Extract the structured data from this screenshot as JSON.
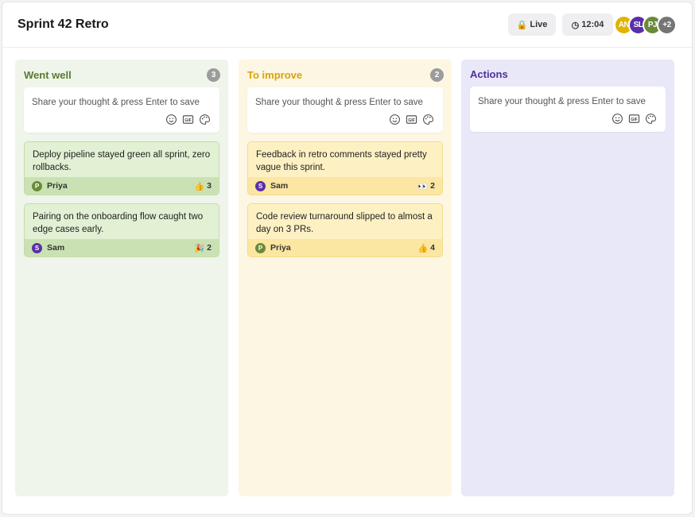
{
  "header": {
    "title": "Sprint 42 Retro",
    "live_label": "Live",
    "live_icon": "lock-icon",
    "timer_label": "12:04",
    "timer_icon": "clock-icon"
  },
  "participants": {
    "avatars": [
      {
        "initials": "AN",
        "color": "#e0b400"
      },
      {
        "initials": "SL",
        "color": "#5b2fa8"
      },
      {
        "initials": "PJ",
        "color": "#6a8a3a"
      }
    ],
    "overflow_label": "+2",
    "overflow_color": "#757575"
  },
  "columns": [
    {
      "title": "Went well",
      "count": "3",
      "color": "#5a7a2f",
      "placeholder": "Share your thought & press Enter to save",
      "cards": [
        {
          "text": "Deploy pipeline stayed green all sprint, zero rollbacks.",
          "author": "Priya",
          "initial": "P",
          "avatar_color": "#6a8a3a",
          "reaction": "👍",
          "reaction_count": "3"
        },
        {
          "text": "Pairing on the onboarding flow caught two edge cases early.",
          "author": "Sam",
          "initial": "S",
          "avatar_color": "#5b2fa8",
          "reaction": "🎉",
          "reaction_count": "2"
        }
      ]
    },
    {
      "title": "To improve",
      "count": "2",
      "color": "#d7a40c",
      "placeholder": "Share your thought & press Enter to save",
      "cards": [
        {
          "text": "Feedback in retro comments stayed pretty vague this sprint.",
          "author": "Sam",
          "initial": "S",
          "avatar_color": "#5b2fa8",
          "reaction": "👀",
          "reaction_count": "2"
        },
        {
          "text": "Code review turnaround slipped to almost a day on 3 PRs.",
          "author": "Priya",
          "initial": "P",
          "avatar_color": "#6a8a3a",
          "reaction": "👍",
          "reaction_count": "4"
        }
      ]
    },
    {
      "title": "Actions",
      "color": "#4f2f98",
      "placeholder": "Share your thought & press Enter to save",
      "cards": []
    }
  ],
  "input_tools": [
    "emoji-icon",
    "gif-icon",
    "palette-icon"
  ]
}
